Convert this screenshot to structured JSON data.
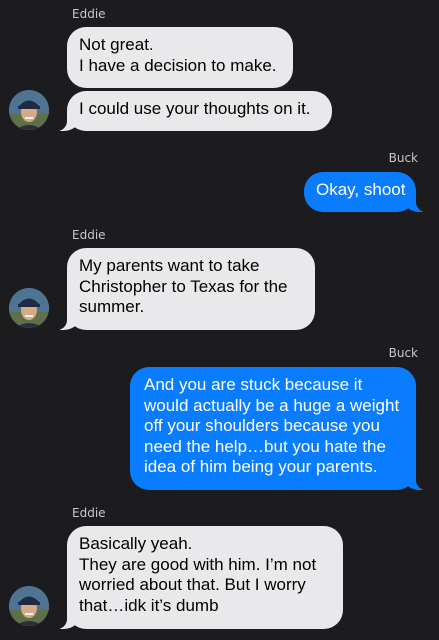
{
  "conversation": {
    "messages": [
      {
        "sender": "Eddie",
        "direction": "incoming",
        "bubbles": [
          {
            "lines": [
              "Not great.",
              "I have a decision to make."
            ]
          },
          {
            "lines": [
              "I could use your thoughts on it."
            ]
          }
        ],
        "avatar_icon": "contact-avatar-icon"
      },
      {
        "sender": "Buck",
        "direction": "outgoing",
        "bubbles": [
          {
            "lines": [
              "Okay, shoot"
            ]
          }
        ]
      },
      {
        "sender": "Eddie",
        "direction": "incoming",
        "bubbles": [
          {
            "lines": [
              "My parents want to take",
              "Christopher to Texas for the",
              "summer."
            ]
          }
        ],
        "avatar_icon": "contact-avatar-icon"
      },
      {
        "sender": "Buck",
        "direction": "outgoing",
        "bubbles": [
          {
            "lines": [
              "And you are stuck because it",
              "would actually be a huge a weight",
              "off your shoulders because you",
              "need the help…but you hate the",
              "idea of him being your parents."
            ]
          }
        ]
      },
      {
        "sender": "Eddie",
        "direction": "incoming",
        "bubbles": [
          {
            "lines": [
              "Basically yeah.",
              "They are good with him. I’m not",
              "worried about that. But I worry",
              "that…idk it’s dumb"
            ]
          }
        ],
        "avatar_icon": "contact-avatar-icon"
      }
    ]
  },
  "colors": {
    "background": "#1c1c1e",
    "incoming_bubble": "#e9e9eb",
    "outgoing_bubble": "#0a7cff",
    "sender_label": "#c9c9cc"
  }
}
